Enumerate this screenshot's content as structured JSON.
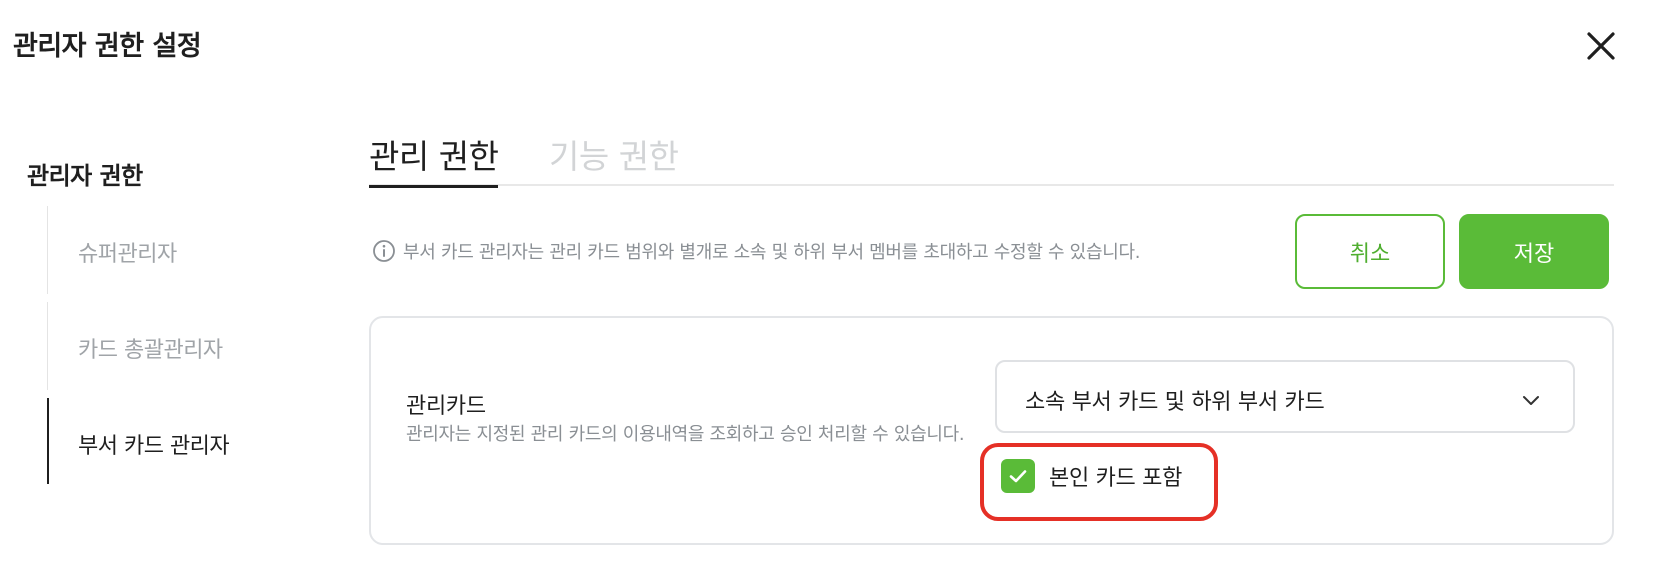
{
  "modal": {
    "title": "관리자 권한 설정",
    "close_icon": "close-icon"
  },
  "sidebar": {
    "heading": "관리자 권한",
    "items": [
      {
        "label": "슈퍼관리자",
        "active": false
      },
      {
        "label": "카드 총괄관리자",
        "active": false
      },
      {
        "label": "부서 카드 관리자",
        "active": true
      }
    ]
  },
  "tabs": [
    {
      "label": "관리 권한",
      "active": true
    },
    {
      "label": "기능 권한",
      "active": false
    }
  ],
  "info": {
    "icon": "info-icon",
    "text": "부서 카드 관리자는 관리 카드 범위와 별개로 소속 및 하위 부서 멤버를 초대하고 수정할 수 있습니다."
  },
  "actions": {
    "cancel_label": "취소",
    "save_label": "저장"
  },
  "card_field": {
    "label": "관리카드",
    "description": "관리자는 지정된 관리 카드의 이용내역을 조회하고 승인 처리할 수 있습니다.",
    "select_value": "소속 부서 카드 및 하위 부서 카드",
    "checkbox_label": "본인 카드 포함",
    "checkbox_checked": true
  },
  "colors": {
    "accent": "#5abb38",
    "highlight": "#e53026",
    "muted_text": "#8a8f94",
    "inactive_tab": "#d2d4d6"
  }
}
